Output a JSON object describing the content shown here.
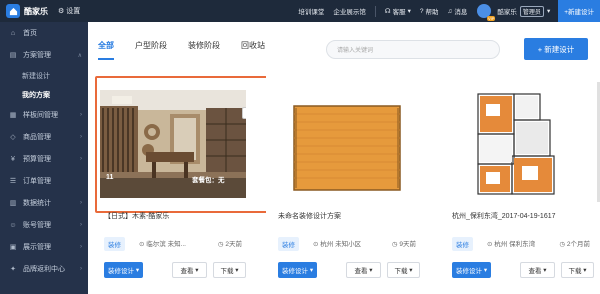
{
  "topbar": {
    "app_name": "酷家乐",
    "settings": "设置",
    "links": [
      "培训课堂",
      "企业展示馆",
      "客服",
      "帮助",
      "消息"
    ],
    "user_name": "酷家乐",
    "role": "管理员",
    "vip": "VIP",
    "new_design": "+新建设计"
  },
  "sidebar": {
    "items": [
      {
        "label": "首页",
        "icon": "home-icon"
      },
      {
        "label": "方案管理",
        "icon": "plan-icon"
      },
      {
        "label": "样板间管理",
        "icon": "layout-icon"
      },
      {
        "label": "商品管理",
        "icon": "goods-icon"
      },
      {
        "label": "预算管理",
        "icon": "budget-icon"
      },
      {
        "label": "订单管理",
        "icon": "order-icon"
      },
      {
        "label": "数据统计",
        "icon": "stats-icon"
      },
      {
        "label": "账号管理",
        "icon": "account-icon"
      },
      {
        "label": "展示管理",
        "icon": "display-icon"
      },
      {
        "label": "品牌返利中心",
        "icon": "brand-icon"
      }
    ],
    "sub_items": [
      "新建设计",
      "我的方案"
    ]
  },
  "tabs": [
    "全部",
    "户型阶段",
    "装修阶段",
    "回收站"
  ],
  "search": {
    "placeholder": "请输入关键词"
  },
  "new_button": "+ 新建设计",
  "cards": [
    {
      "title": "【日式】木素-酷家乐",
      "tag": "装修",
      "location": "临尔滨 未知...",
      "time": "2天前",
      "count": "11",
      "package": "套餐包：无",
      "deco_label": "装修设计",
      "view_label": "查看",
      "dl_label": "下载"
    },
    {
      "title": "未命名装修设计方案",
      "tag": "装修",
      "location": "杭州 未知小区",
      "time": "9天前",
      "deco_label": "装修设计",
      "view_label": "查看",
      "dl_label": "下载"
    },
    {
      "title": "杭州_保利东湾_2017-04-19-1617",
      "tag": "装修",
      "location": "杭州 保利东湾",
      "time": "2个月前",
      "deco_label": "装修设计",
      "view_label": "查看",
      "dl_label": "下载"
    }
  ],
  "colors": {
    "accent": "#2a7de1",
    "highlight": "#e96a3a",
    "sidebar": "#25324a"
  }
}
